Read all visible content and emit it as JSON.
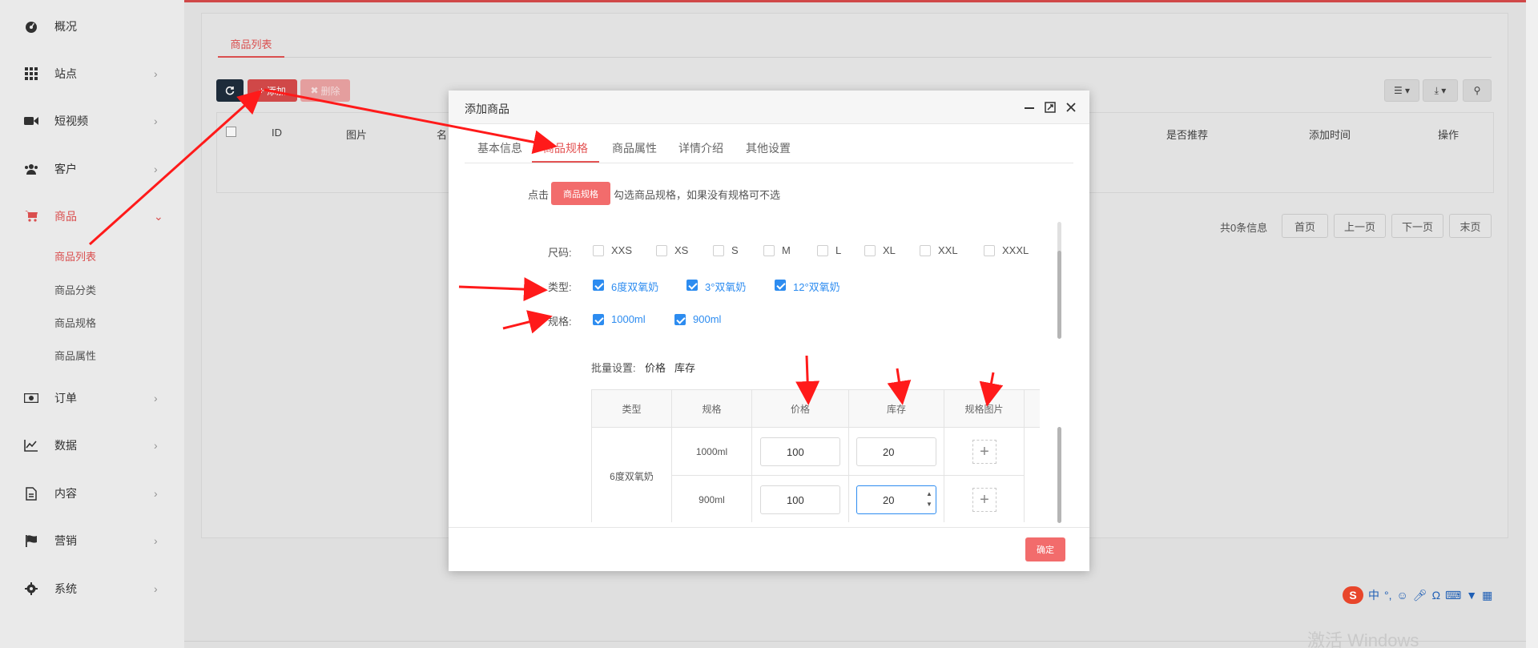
{
  "sidebar": {
    "items": [
      {
        "label": "概况",
        "icon": "dashboard-icon"
      },
      {
        "label": "站点",
        "icon": "grid-icon"
      },
      {
        "label": "短视频",
        "icon": "video-camera-icon"
      },
      {
        "label": "客户",
        "icon": "users-icon"
      },
      {
        "label": "商品",
        "icon": "cart-icon"
      },
      {
        "label": "订单",
        "icon": "money-icon"
      },
      {
        "label": "数据",
        "icon": "chart-line-icon"
      },
      {
        "label": "内容",
        "icon": "file-icon"
      },
      {
        "label": "营销",
        "icon": "flag-icon"
      },
      {
        "label": "系统",
        "icon": "gear-icon"
      }
    ],
    "sub_items": [
      "商品列表",
      "商品分类",
      "商品规格",
      "商品属性"
    ]
  },
  "main": {
    "tab_label": "商品列表",
    "toolbar": {
      "add_label": "添加",
      "delete_label": "删除"
    },
    "table_headers": [
      "ID",
      "图片",
      "名",
      "是否推荐",
      "添加时间",
      "操作"
    ],
    "pager": {
      "summary": "共0条信息",
      "first": "首页",
      "prev": "上一页",
      "next": "下一页",
      "last": "末页"
    }
  },
  "modal": {
    "title": "添加商品",
    "tabs": [
      "基本信息",
      "商品规格",
      "商品属性",
      "详情介绍",
      "其他设置"
    ],
    "active_tab": "商品规格",
    "hint": {
      "prefix": "点击",
      "button": "商品规格",
      "suffix": "勾选商品规格，如果没有规格可不选"
    },
    "size": {
      "label": "尺码:",
      "options": [
        "XXS",
        "XS",
        "S",
        "M",
        "L",
        "XL",
        "XXL",
        "XXXL"
      ]
    },
    "type": {
      "label": "类型:",
      "options": [
        "6度双氧奶",
        "3°双氧奶",
        "12°双氧奶"
      ]
    },
    "spec": {
      "label": "规格:",
      "options": [
        "1000ml",
        "900ml"
      ]
    },
    "batch": {
      "label": "批量设置:",
      "price": "价格",
      "stock": "库存"
    },
    "grid_headers": [
      "类型",
      "规格",
      "价格",
      "库存",
      "规格图片"
    ],
    "grid_type": "6度双氧奶",
    "rows": [
      {
        "spec": "1000ml",
        "price": "100",
        "stock": "20"
      },
      {
        "spec": "900ml",
        "price": "100",
        "stock": "20"
      }
    ],
    "ok_label": "确定"
  },
  "ime": {
    "label": "中"
  },
  "watermark": "激活 Windows",
  "colors": {
    "accent": "#e35353",
    "check": "#2d8cf0",
    "arrow": "#ff1a1a"
  }
}
